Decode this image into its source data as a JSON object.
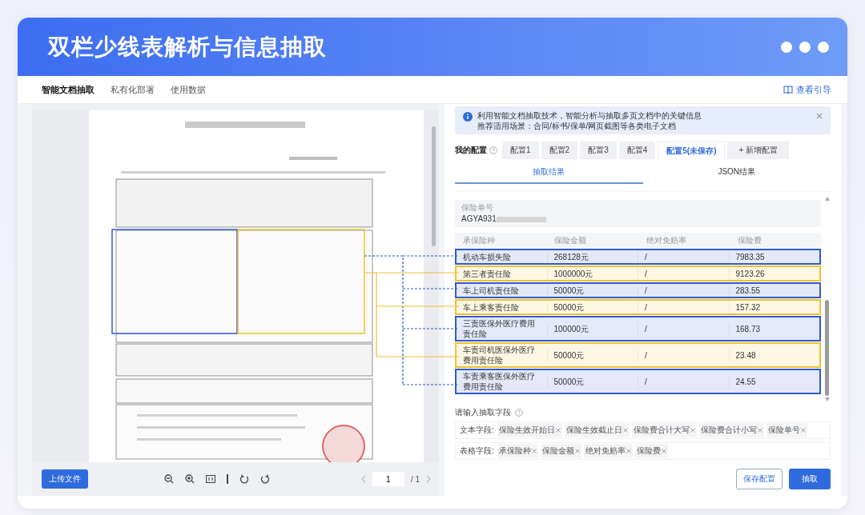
{
  "header": {
    "title": "双栏少线表解析与信息抽取"
  },
  "nav": {
    "tabs": [
      {
        "label": "智能文档抽取",
        "selected": true
      },
      {
        "label": "私有化部署",
        "selected": false
      },
      {
        "label": "使用数据",
        "selected": false
      }
    ],
    "guide_link": "查看引导"
  },
  "viewer": {
    "upload_button": "上传文件",
    "page_input": "1",
    "page_total": "/ 1"
  },
  "notice": {
    "lines": [
      "利用智能文档抽取技术，智能分析与抽取多页文档中的关键信息",
      "推荐适用场景：合同/标书/保单/网页截图等各类电子文档"
    ]
  },
  "config": {
    "label": "我的配置",
    "tabs": [
      {
        "label": "配置1",
        "selected": false
      },
      {
        "label": "配置2",
        "selected": false
      },
      {
        "label": "配置3",
        "selected": false
      },
      {
        "label": "配置4",
        "selected": false
      },
      {
        "label": "配置5(未保存)",
        "selected": true
      }
    ],
    "add_button": "+ 新增配置"
  },
  "result_tabs": [
    {
      "label": "抽取结果",
      "selected": true
    },
    {
      "label": "JSON结果",
      "selected": false
    }
  ],
  "policy_field": {
    "label": "保险单号",
    "value": "AGYA931"
  },
  "table": {
    "columns": [
      "承保险种",
      "保险金额",
      "绝对免赔率",
      "保险费"
    ],
    "rows": [
      {
        "cells": [
          "机动车损失险",
          "268128元",
          "/",
          "7983.35"
        ],
        "color": "#2f5bd0"
      },
      {
        "cells": [
          "第三者责任险",
          "1000000元",
          "/",
          "9123.26"
        ],
        "color": "#f0c030"
      },
      {
        "cells": [
          "车上司机责任险",
          "50000元",
          "/",
          "283.55"
        ],
        "color": "#2f5bd0"
      },
      {
        "cells": [
          "车上乘客责任险",
          "50000元",
          "/",
          "157.32"
        ],
        "color": "#f0c030"
      },
      {
        "cells": [
          "三责医保外医疗费用责任险",
          "100000元",
          "/",
          "168.73"
        ],
        "color": "#2f5bd0"
      },
      {
        "cells": [
          "车责司机医保外医疗费用责任险",
          "50000元",
          "/",
          "23.48"
        ],
        "color": "#f0c030"
      },
      {
        "cells": [
          "车责乘客医保外医疗费用责任险",
          "50000元",
          "/",
          "24.55"
        ],
        "color": "#2f5bd0"
      }
    ]
  },
  "fields": {
    "label": "请输入抽取字段",
    "groups": [
      {
        "label": "文本字段:",
        "tags": [
          "保险生效开始日",
          "保险生效截止日",
          "保险费合计大写",
          "保险费合计小写",
          "保险单号"
        ]
      },
      {
        "label": "表格字段:",
        "tags": [
          "承保险种",
          "保险金额",
          "绝对免赔率",
          "保险费"
        ]
      }
    ]
  },
  "buttons": {
    "save": "保存配置",
    "extract": "抽取"
  }
}
